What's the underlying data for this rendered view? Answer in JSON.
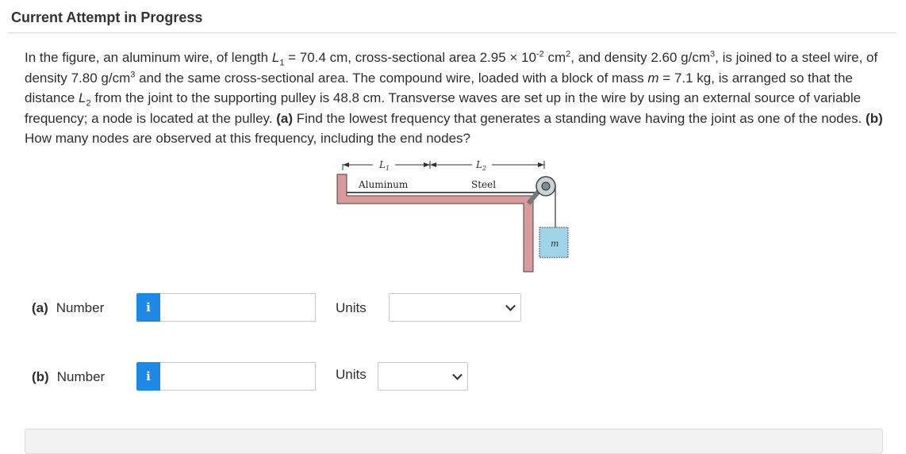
{
  "header": {
    "title": "Current Attempt in Progress"
  },
  "problem": {
    "t1": "In the figure, an aluminum wire, of length ",
    "L1_sym": "L",
    "L1_sub": "1",
    "t2": " = 70.4 cm, cross-sectional area 2.95 × 10",
    "exp1": "-2",
    "t3": " cm",
    "exp2": "2",
    "t4": ", and density 2.60 g/cm",
    "exp3": "3",
    "t5": ", is joined to a steel wire, of density 7.80 g/cm",
    "exp4": "3",
    "t6": " and the same cross-sectional area. The compound wire, loaded with a block of mass ",
    "m_sym": "m",
    "t7": " = 7.1 kg, is arranged so that the distance ",
    "L2_sym": "L",
    "L2_sub": "2",
    "t8": " from the joint to the supporting pulley is 48.8 cm. Transverse waves are set up in the wire by using an external source of variable frequency; a node is located at the pulley. ",
    "part_a_label": "(a)",
    "part_a_text": " Find the lowest frequency that generates a standing wave having the joint as one of the nodes. ",
    "part_b_label": "(b)",
    "part_b_text": " How many nodes are observed at this frequency, including the end nodes?"
  },
  "figure": {
    "L1_label": "L",
    "L1_sub": "1",
    "L2_label": "L",
    "L2_sub": "2",
    "aluminum_label": "Aluminum",
    "steel_label": "Steel",
    "mass_label": "m",
    "wire_color": "#d99a9c",
    "block_color": "#9fd3e6"
  },
  "answers": [
    {
      "part": "(a)",
      "label": "Number",
      "info_icon": "i",
      "value": "",
      "units_label": "Units",
      "units_value": ""
    },
    {
      "part": "(b)",
      "label": "Number",
      "info_icon": "i",
      "value": "",
      "units_label": "Units",
      "units_value": ""
    }
  ],
  "colors": {
    "info_button": "#1e88e5"
  }
}
